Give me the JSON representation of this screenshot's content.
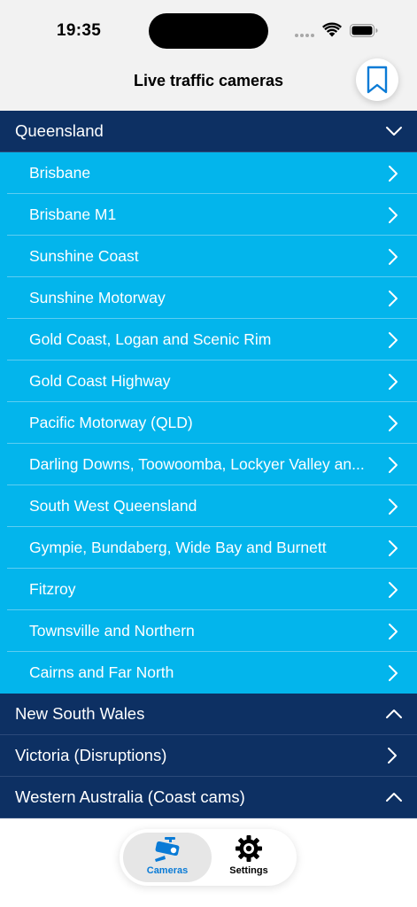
{
  "status_bar": {
    "time": "19:35"
  },
  "nav": {
    "title": "Live traffic cameras",
    "bookmark_icon": "bookmark-icon"
  },
  "colors": {
    "section_header": "#0d3063",
    "row": "#03b5ec",
    "active_tab": "#0a7bd6"
  },
  "sections": [
    {
      "title": "Queensland",
      "state": "expanded",
      "items": [
        "Brisbane",
        "Brisbane M1",
        "Sunshine Coast",
        "Sunshine Motorway",
        "Gold Coast, Logan and Scenic Rim",
        "Gold Coast Highway",
        "Pacific Motorway (QLD)",
        "Darling Downs, Toowoomba, Lockyer Valley an...",
        "South West Queensland",
        "Gympie, Bundaberg, Wide Bay and Burnett",
        "Fitzroy",
        "Townsville and Northern",
        "Cairns and Far North"
      ]
    },
    {
      "title": "New South Wales",
      "state": "collapsed"
    },
    {
      "title": "Victoria (Disruptions)",
      "state": "link"
    },
    {
      "title": "Western Australia (Coast cams)",
      "state": "collapsed"
    }
  ],
  "tabs": [
    {
      "label": "Cameras",
      "icon": "camera-icon",
      "active": true
    },
    {
      "label": "Settings",
      "icon": "gear-icon",
      "active": false
    }
  ]
}
